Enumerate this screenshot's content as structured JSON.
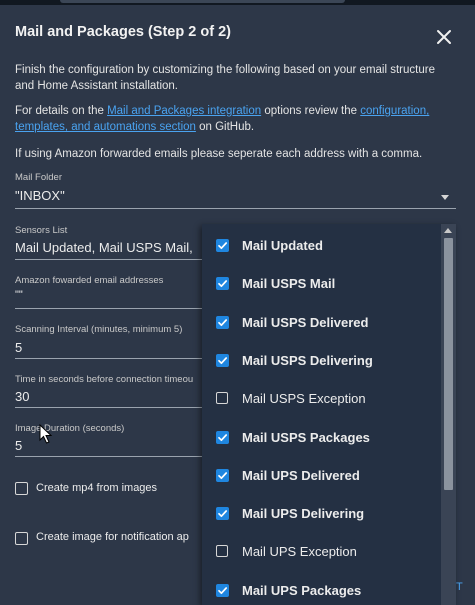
{
  "dialog": {
    "title": "Mail and Packages (Step 2 of 2)",
    "intro": "Finish the configuration by customizing the following based on your email structure and Home Assistant installation.",
    "details_prefix": "For details on the ",
    "details_link1": "Mail and Packages integration",
    "details_middle": " options review the ",
    "details_link2": "configuration, templates, and automations section",
    "details_suffix": " on GitHub.",
    "amazon_note": "If using Amazon forwarded emails please seperate each address with a comma."
  },
  "fields": {
    "mail_folder": {
      "label": "Mail Folder",
      "value": "\"INBOX\""
    },
    "sensors_list": {
      "label": "Sensors List",
      "value": "Mail Updated, Mail USPS Mail,"
    },
    "amazon_addresses": {
      "label": "Amazon fowarded email addresses",
      "value": "\"\""
    },
    "scanning_interval": {
      "label": "Scanning Interval (minutes, minimum 5)",
      "value": "5"
    },
    "connection_timeout": {
      "label": "Time in seconds before connection timeou",
      "value": "30"
    },
    "image_duration": {
      "label": "Image Duration (seconds)",
      "value": "5"
    }
  },
  "checkboxes": {
    "create_mp4": {
      "label": "Create mp4 from images",
      "checked": false
    },
    "create_image_notification": {
      "label": "Create image for notification ap",
      "checked": false
    }
  },
  "sensor_options": [
    {
      "label": "Mail Updated",
      "checked": true
    },
    {
      "label": "Mail USPS Mail",
      "checked": true
    },
    {
      "label": "Mail USPS Delivered",
      "checked": true
    },
    {
      "label": "Mail USPS Delivering",
      "checked": true
    },
    {
      "label": "Mail USPS Exception",
      "checked": false
    },
    {
      "label": "Mail USPS Packages",
      "checked": true
    },
    {
      "label": "Mail UPS Delivered",
      "checked": true
    },
    {
      "label": "Mail UPS Delivering",
      "checked": true
    },
    {
      "label": "Mail UPS Exception",
      "checked": false
    },
    {
      "label": "Mail UPS Packages",
      "checked": true
    }
  ],
  "footer_fragment": "T",
  "colors": {
    "background": "#2d3748",
    "accent": "#1f86e0",
    "link": "#4aa3f0",
    "dropdown": "#243043"
  }
}
